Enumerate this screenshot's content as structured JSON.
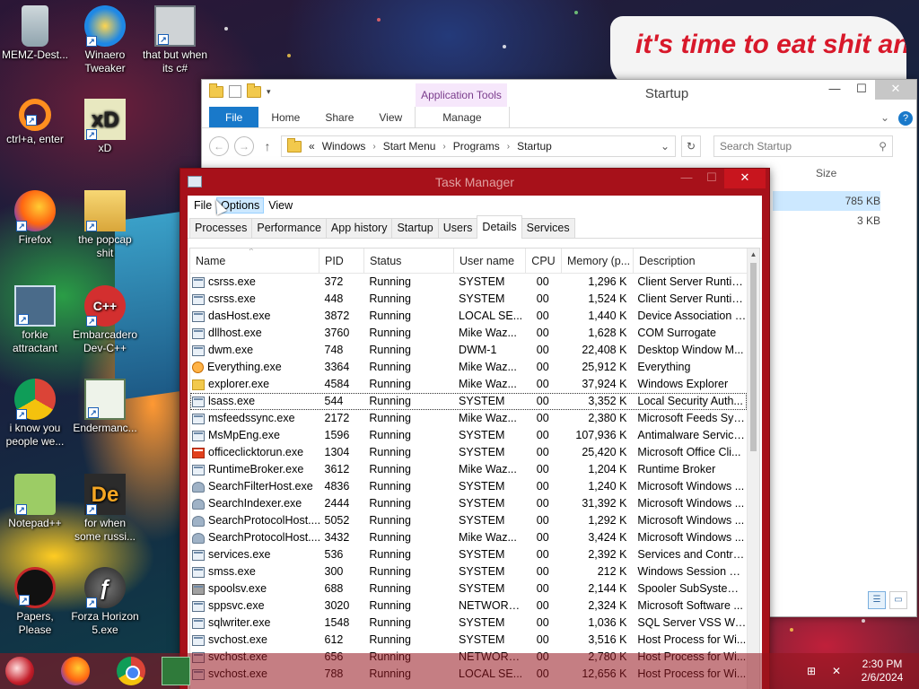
{
  "desktop": {
    "icons": [
      {
        "label": "MEMZ-Dest...",
        "icon": "recycle-bin-icon"
      },
      {
        "label": "Winaero Tweaker",
        "icon": "winaero-icon"
      },
      {
        "label": "that but when its c#",
        "icon": "stack-icon"
      },
      {
        "label": "ctrl+a, enter",
        "icon": "ring-icon"
      },
      {
        "label": "xD",
        "icon": "hxd-icon"
      },
      {
        "label": "Firefox",
        "icon": "firefox-icon"
      },
      {
        "label": "the popcap shit",
        "icon": "folder-icon"
      },
      {
        "label": "forkie attractant",
        "icon": "monitor-gear-icon"
      },
      {
        "label": "Embarcadero Dev-C++",
        "icon": "devcpp-icon"
      },
      {
        "label": "i know you people we...",
        "icon": "chrome-icon"
      },
      {
        "label": "Endermanc...",
        "icon": "app-window-icon"
      },
      {
        "label": "Notepad++",
        "icon": "notepadpp-icon"
      },
      {
        "label": "for when some russi...",
        "icon": "de-icon"
      },
      {
        "label": "Papers, Please",
        "icon": "papers-please-icon"
      },
      {
        "label": "Forza Horizon 5.exe",
        "icon": "flash-icon"
      }
    ],
    "wallpaper_sign_text": "it's time to eat shit and die andcelebrate"
  },
  "explorer": {
    "app_tools_label": "Application Tools",
    "title": "Startup",
    "minimize": "—",
    "maximize": "☐",
    "close": "✕",
    "tabs": {
      "file": "File",
      "home": "Home",
      "share": "Share",
      "view": "View",
      "manage": "Manage"
    },
    "address": {
      "root": "«",
      "parts": [
        "Windows",
        "Start Menu",
        "Programs",
        "Startup"
      ]
    },
    "search_placeholder": "Search Startup",
    "column_size": "Size",
    "sizes": [
      "785 KB",
      "3 KB"
    ]
  },
  "taskmgr": {
    "title": "Task Manager",
    "menu": {
      "file": "File",
      "options": "Options",
      "view": "View"
    },
    "tabs": [
      "Processes",
      "Performance",
      "App history",
      "Startup",
      "Users",
      "Details",
      "Services"
    ],
    "active_tab": "Details",
    "columns": {
      "name": "Name",
      "pid": "PID",
      "status": "Status",
      "user": "User name",
      "cpu": "CPU",
      "memory": "Memory (p...",
      "description": "Description"
    },
    "rows": [
      {
        "icon": "app",
        "name": "csrss.exe",
        "pid": "372",
        "status": "Running",
        "user": "SYSTEM",
        "cpu": "00",
        "mem": "1,296 K",
        "desc": "Client Server Runtim..."
      },
      {
        "icon": "app",
        "name": "csrss.exe",
        "pid": "448",
        "status": "Running",
        "user": "SYSTEM",
        "cpu": "00",
        "mem": "1,524 K",
        "desc": "Client Server Runtim..."
      },
      {
        "icon": "app",
        "name": "dasHost.exe",
        "pid": "3872",
        "status": "Running",
        "user": "LOCAL SE...",
        "cpu": "00",
        "mem": "1,440 K",
        "desc": "Device Association F..."
      },
      {
        "icon": "app",
        "name": "dllhost.exe",
        "pid": "3760",
        "status": "Running",
        "user": "Mike Waz...",
        "cpu": "00",
        "mem": "1,628 K",
        "desc": "COM Surrogate"
      },
      {
        "icon": "app",
        "name": "dwm.exe",
        "pid": "748",
        "status": "Running",
        "user": "DWM-1",
        "cpu": "00",
        "mem": "22,408 K",
        "desc": "Desktop Window M..."
      },
      {
        "icon": "search",
        "name": "Everything.exe",
        "pid": "3364",
        "status": "Running",
        "user": "Mike Waz...",
        "cpu": "00",
        "mem": "25,912 K",
        "desc": "Everything"
      },
      {
        "icon": "folder",
        "name": "explorer.exe",
        "pid": "4584",
        "status": "Running",
        "user": "Mike Waz...",
        "cpu": "00",
        "mem": "37,924 K",
        "desc": "Windows Explorer"
      },
      {
        "icon": "app",
        "name": "lsass.exe",
        "pid": "544",
        "status": "Running",
        "user": "SYSTEM",
        "cpu": "00",
        "mem": "3,352 K",
        "desc": "Local Security Auth..."
      },
      {
        "icon": "app",
        "name": "msfeedssync.exe",
        "pid": "2172",
        "status": "Running",
        "user": "Mike Waz...",
        "cpu": "00",
        "mem": "2,380 K",
        "desc": "Microsoft Feeds Syn..."
      },
      {
        "icon": "app",
        "name": "MsMpEng.exe",
        "pid": "1596",
        "status": "Running",
        "user": "SYSTEM",
        "cpu": "00",
        "mem": "107,936 K",
        "desc": "Antimalware Service..."
      },
      {
        "icon": "office",
        "name": "officeclicktorun.exe",
        "pid": "1304",
        "status": "Running",
        "user": "SYSTEM",
        "cpu": "00",
        "mem": "25,420 K",
        "desc": "Microsoft Office Cli..."
      },
      {
        "icon": "app",
        "name": "RuntimeBroker.exe",
        "pid": "3612",
        "status": "Running",
        "user": "Mike Waz...",
        "cpu": "00",
        "mem": "1,204 K",
        "desc": "Runtime Broker"
      },
      {
        "icon": "person",
        "name": "SearchFilterHost.exe",
        "pid": "4836",
        "status": "Running",
        "user": "SYSTEM",
        "cpu": "00",
        "mem": "1,240 K",
        "desc": "Microsoft Windows ..."
      },
      {
        "icon": "person",
        "name": "SearchIndexer.exe",
        "pid": "2444",
        "status": "Running",
        "user": "SYSTEM",
        "cpu": "00",
        "mem": "31,392 K",
        "desc": "Microsoft Windows ..."
      },
      {
        "icon": "person",
        "name": "SearchProtocolHost....",
        "pid": "5052",
        "status": "Running",
        "user": "SYSTEM",
        "cpu": "00",
        "mem": "1,292 K",
        "desc": "Microsoft Windows ..."
      },
      {
        "icon": "person",
        "name": "SearchProtocolHost....",
        "pid": "3432",
        "status": "Running",
        "user": "Mike Waz...",
        "cpu": "00",
        "mem": "3,424 K",
        "desc": "Microsoft Windows ..."
      },
      {
        "icon": "app",
        "name": "services.exe",
        "pid": "536",
        "status": "Running",
        "user": "SYSTEM",
        "cpu": "00",
        "mem": "2,392 K",
        "desc": "Services and Control..."
      },
      {
        "icon": "app",
        "name": "smss.exe",
        "pid": "300",
        "status": "Running",
        "user": "SYSTEM",
        "cpu": "00",
        "mem": "212 K",
        "desc": "Windows Session M..."
      },
      {
        "icon": "printer",
        "name": "spoolsv.exe",
        "pid": "688",
        "status": "Running",
        "user": "SYSTEM",
        "cpu": "00",
        "mem": "2,144 K",
        "desc": "Spooler SubSystem ..."
      },
      {
        "icon": "app",
        "name": "sppsvc.exe",
        "pid": "3020",
        "status": "Running",
        "user": "NETWORK...",
        "cpu": "00",
        "mem": "2,324 K",
        "desc": "Microsoft Software ..."
      },
      {
        "icon": "app",
        "name": "sqlwriter.exe",
        "pid": "1548",
        "status": "Running",
        "user": "SYSTEM",
        "cpu": "00",
        "mem": "1,036 K",
        "desc": "SQL Server VSS Writ..."
      },
      {
        "icon": "app",
        "name": "svchost.exe",
        "pid": "612",
        "status": "Running",
        "user": "SYSTEM",
        "cpu": "00",
        "mem": "3,516 K",
        "desc": "Host Process for Wi..."
      },
      {
        "icon": "app",
        "name": "svchost.exe",
        "pid": "656",
        "status": "Running",
        "user": "NETWORK...",
        "cpu": "00",
        "mem": "2,780 K",
        "desc": "Host Process for Wi..."
      },
      {
        "icon": "app",
        "name": "svchost.exe",
        "pid": "788",
        "status": "Running",
        "user": "LOCAL SE...",
        "cpu": "00",
        "mem": "12,656 K",
        "desc": "Host Process for Wi..."
      }
    ],
    "selected_index": 7
  },
  "taskbar": {
    "clock_time": "2:30 PM",
    "clock_date": "2/6/2024"
  }
}
